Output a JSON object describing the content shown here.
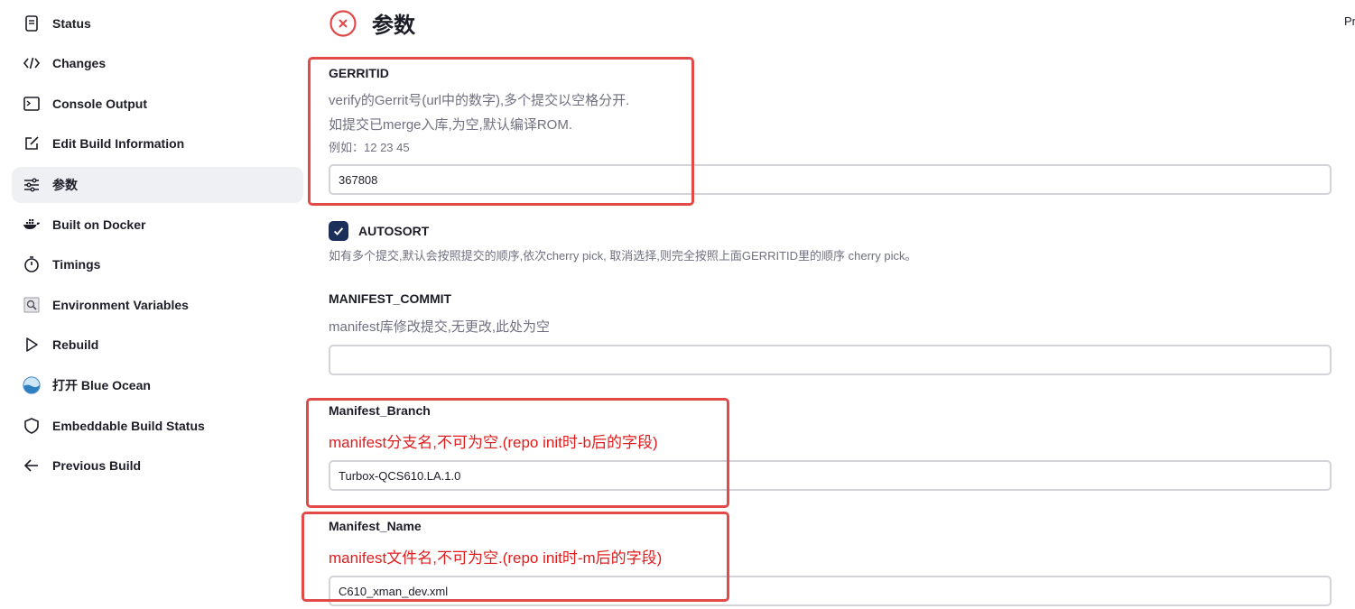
{
  "corner_text": "Pr",
  "sidebar": {
    "items": [
      {
        "label": "Status",
        "icon": "document-icon"
      },
      {
        "label": "Changes",
        "icon": "code-icon"
      },
      {
        "label": "Console Output",
        "icon": "terminal-icon"
      },
      {
        "label": "Edit Build Information",
        "icon": "edit-icon"
      },
      {
        "label": "参数",
        "icon": "sliders-icon",
        "active": true
      },
      {
        "label": "Built on Docker",
        "icon": "docker-icon"
      },
      {
        "label": "Timings",
        "icon": "stopwatch-icon"
      },
      {
        "label": "Environment Variables",
        "icon": "env-vars-icon"
      },
      {
        "label": "Rebuild",
        "icon": "play-icon"
      },
      {
        "label": "打开 Blue Ocean",
        "icon": "blue-ocean-icon"
      },
      {
        "label": "Embeddable Build Status",
        "icon": "shield-icon"
      },
      {
        "label": "Previous Build",
        "icon": "arrow-left-icon"
      }
    ]
  },
  "main": {
    "title": "参数",
    "title_icon": "failed-x-icon",
    "params": {
      "gerritid": {
        "label": "GERRITID",
        "desc1": "verify的Gerrit号(url中的数字),多个提交以空格分开.",
        "desc2": "如提交已merge入库,为空,默认编译ROM.",
        "desc3": "例如：12 23 45",
        "value": "367808"
      },
      "autosort": {
        "label": "AUTOSORT",
        "checked": true,
        "desc": "如有多个提交,默认会按照提交的顺序,依次cherry pick, 取消选择,则完全按照上面GERRITID里的顺序 cherry pick。"
      },
      "manifest_commit": {
        "label": "MANIFEST_COMMIT",
        "desc": "manifest库修改提交,无更改,此处为空",
        "value": ""
      },
      "manifest_branch": {
        "label": "Manifest_Branch",
        "desc": "manifest分支名,不可为空.(repo init时-b后的字段)",
        "value": "Turbox-QCS610.LA.1.0"
      },
      "manifest_name": {
        "label": "Manifest_Name",
        "desc": "manifest文件名,不可为空.(repo init时-m后的字段)",
        "value": "C610_xman_dev.xml"
      }
    }
  },
  "colors": {
    "highlight": "#e24a4a",
    "red_text": "#e01c1c",
    "checkbox": "#1b2f5a",
    "active_bg": "#eef0f3"
  }
}
